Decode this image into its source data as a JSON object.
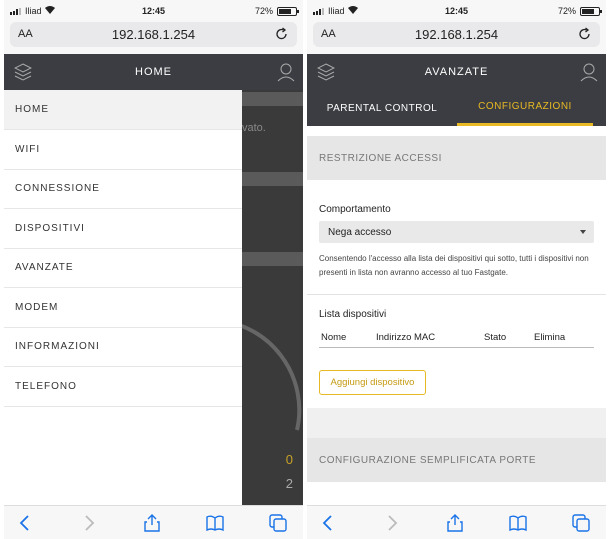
{
  "left": {
    "status": {
      "carrier": "Iliad",
      "time": "12:45",
      "battery": "72%"
    },
    "url": {
      "aa": "AA",
      "address": "192.168.1.254"
    },
    "header_title": "HOME",
    "menu": [
      "HOME",
      "WIFI",
      "CONNESSIONE",
      "DISPOSITIVI",
      "AVANZATE",
      "MODEM",
      "INFORMAZIONI",
      "TELEFONO"
    ],
    "backdrop_text": "vato.",
    "backdrop_num_1": "0",
    "backdrop_num_2": "2"
  },
  "right": {
    "status": {
      "carrier": "Iliad",
      "time": "12:45",
      "battery": "72%"
    },
    "url": {
      "aa": "AA",
      "address": "192.168.1.254"
    },
    "header_title": "AVANZATE",
    "tabs": [
      "PARENTAL CONTROL",
      "CONFIGURAZIONI"
    ],
    "section1": "RESTRIZIONE ACCESSI",
    "behaviour_label": "Comportamento",
    "behaviour_value": "Nega accesso",
    "help_text": "Consentendo l'accesso alla lista dei dispositivi qui sotto, tutti i dispositivi non presenti in lista non avranno accesso al tuo Fastgate.",
    "list_label": "Lista dispositivi",
    "columns": [
      "Nome",
      "Indirizzo MAC",
      "Stato",
      "Elimina"
    ],
    "add_button": "Aggiungi dispositivo",
    "section2": "CONFIGURAZIONE SEMPLIFICATA PORTE"
  },
  "colors": {
    "header": "#3b3d42",
    "accent": "#e8b923"
  },
  "icons": [
    "layers-icon",
    "user-icon",
    "wifi-icon",
    "reload-icon",
    "back-icon",
    "forward-icon",
    "share-icon",
    "bookmarks-icon",
    "tabs-icon",
    "chevron-down-icon"
  ]
}
